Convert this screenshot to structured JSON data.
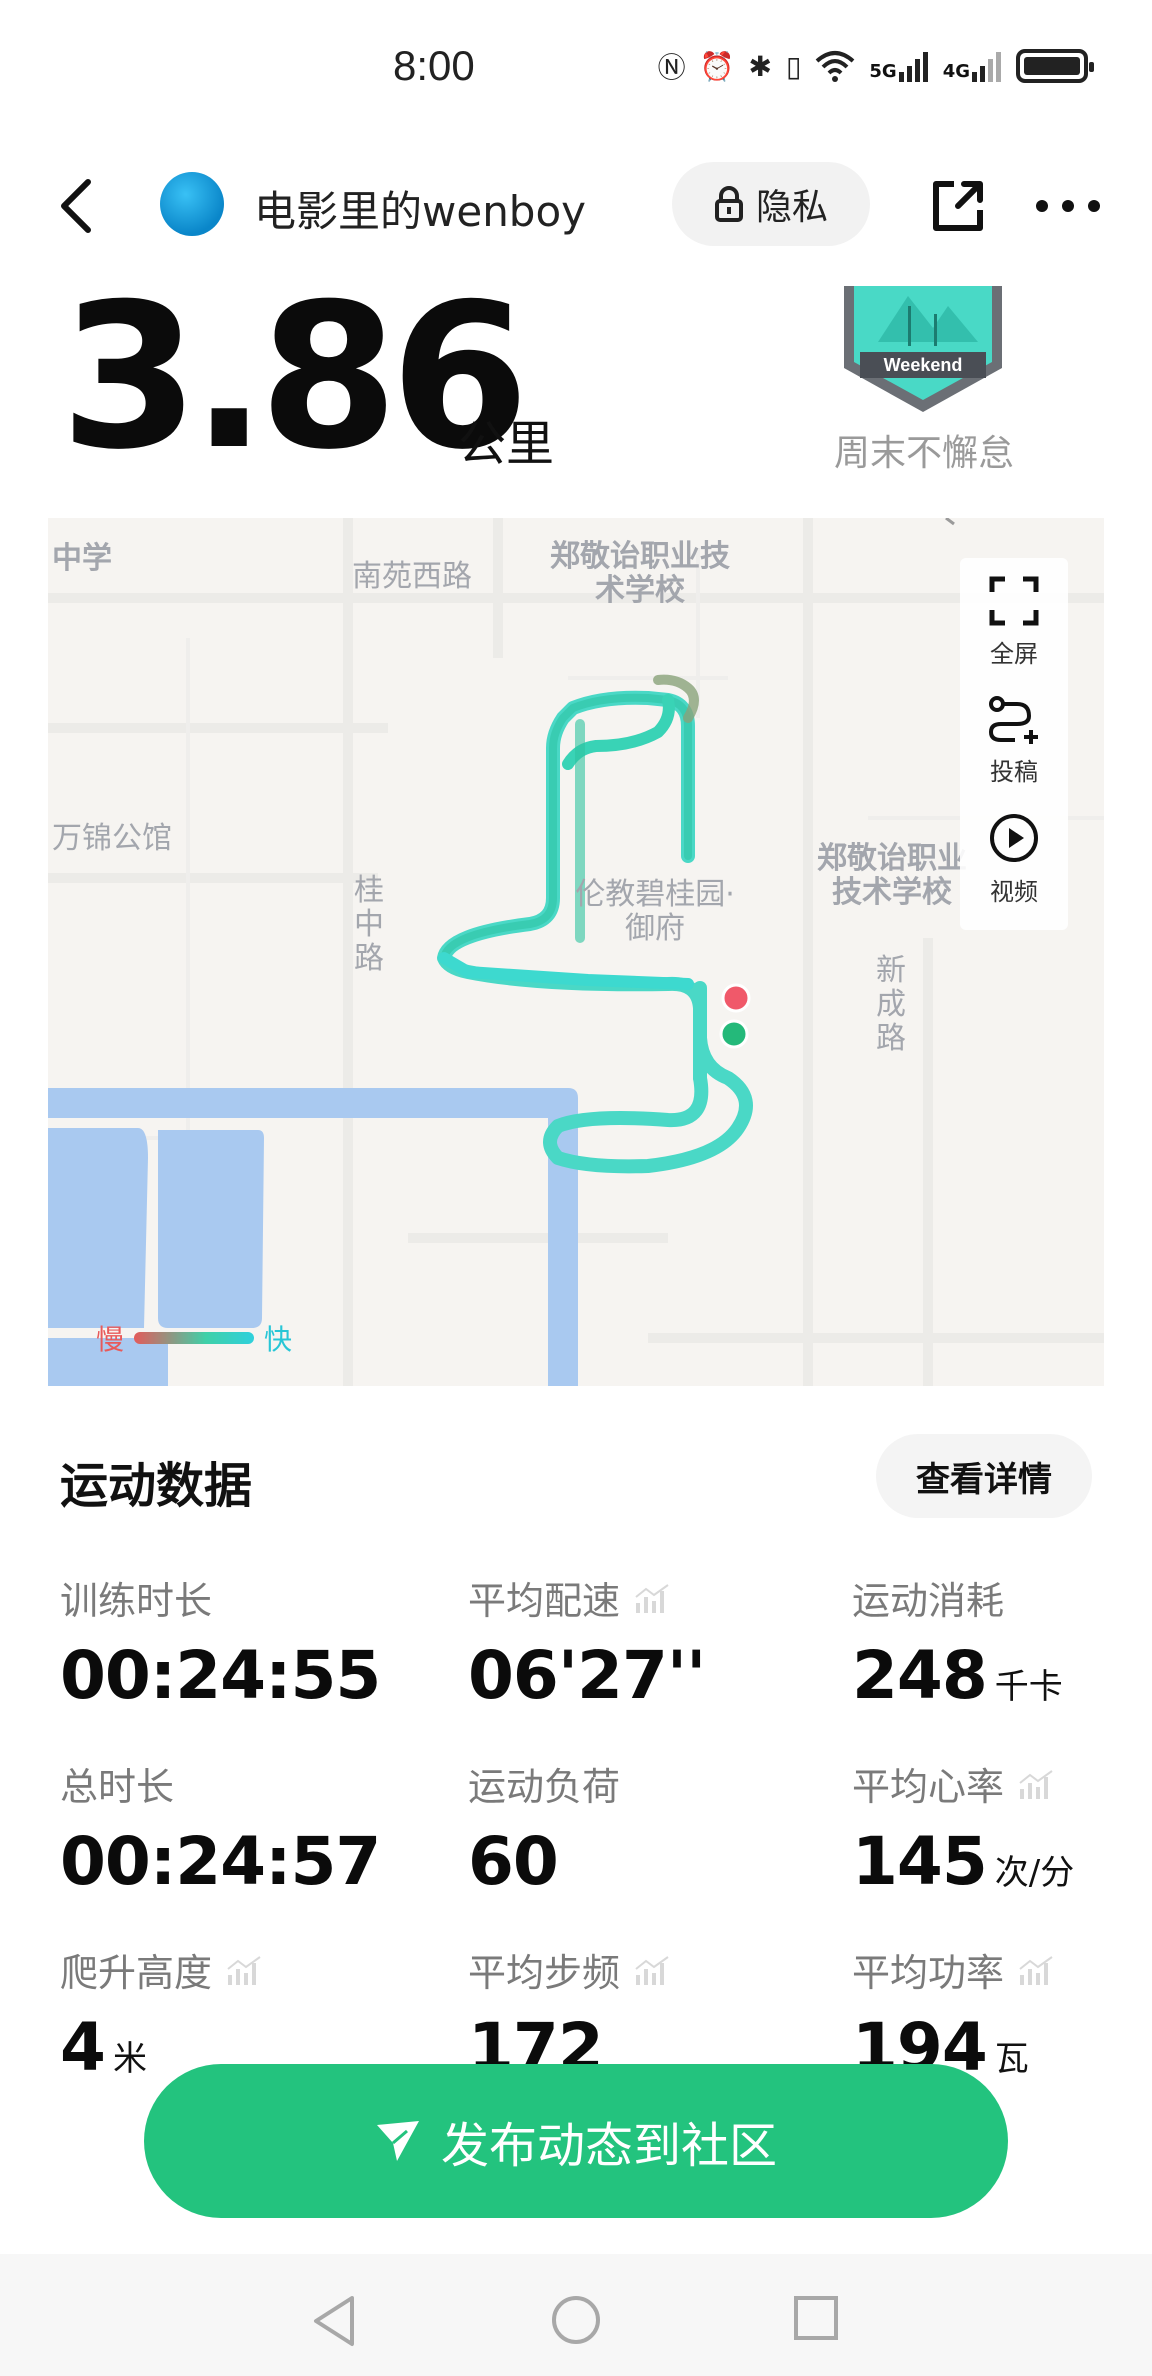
{
  "status_bar": {
    "time": "8:00",
    "icons": [
      "nfc-icon",
      "alarm-icon",
      "bluetooth-icon",
      "vibrate-icon",
      "wifi-icon",
      "signal-5g-icon",
      "signal-4g-icon",
      "battery-icon"
    ],
    "network_5g": "5G",
    "network_4g": "4G"
  },
  "header": {
    "username": "电影里的wenboy",
    "privacy_label": "隐私"
  },
  "summary": {
    "distance": "3.86",
    "distance_unit": "公里",
    "badge_text": "Weekend",
    "badge_caption": "周末不懈怠"
  },
  "map": {
    "labels": [
      "中学",
      "南苑西路",
      "郑敬诒职业技术学校",
      "万锦公馆",
      "桂中路",
      "伦教碧桂园·御府",
      "郑敬诒职业技术学校",
      "新成路"
    ],
    "controls": {
      "fullscreen": "全屏",
      "cast": "投稿",
      "video": "视频"
    },
    "legend": {
      "slow": "慢",
      "fast": "快"
    },
    "colors": {
      "route": "#3ad6b4",
      "start": "#24b97a",
      "end": "#f0596a",
      "water": "#a9c9f0"
    }
  },
  "stats": {
    "title": "运动数据",
    "detail_button": "查看详情",
    "items": [
      {
        "label": "训练时长",
        "value": "00:24:55",
        "unit": ""
      },
      {
        "label": "平均配速",
        "value": "06'27''",
        "unit": ""
      },
      {
        "label": "运动消耗",
        "value": "248",
        "unit": "千卡"
      },
      {
        "label": "总时长",
        "value": "00:24:57",
        "unit": ""
      },
      {
        "label": "运动负荷",
        "value": "60",
        "unit": ""
      },
      {
        "label": "平均心率",
        "value": "145",
        "unit": "次/分"
      },
      {
        "label": "爬升高度",
        "value": "4",
        "unit": "米"
      },
      {
        "label": "平均步频",
        "value": "172",
        "unit": ""
      },
      {
        "label": "平均功率",
        "value": "194",
        "unit": "瓦"
      }
    ]
  },
  "publish": {
    "label": "发布动态到社区",
    "color": "#23c37e"
  },
  "nav": {
    "icons": [
      "back-triangle-icon",
      "home-circle-icon",
      "recents-square-icon"
    ]
  }
}
